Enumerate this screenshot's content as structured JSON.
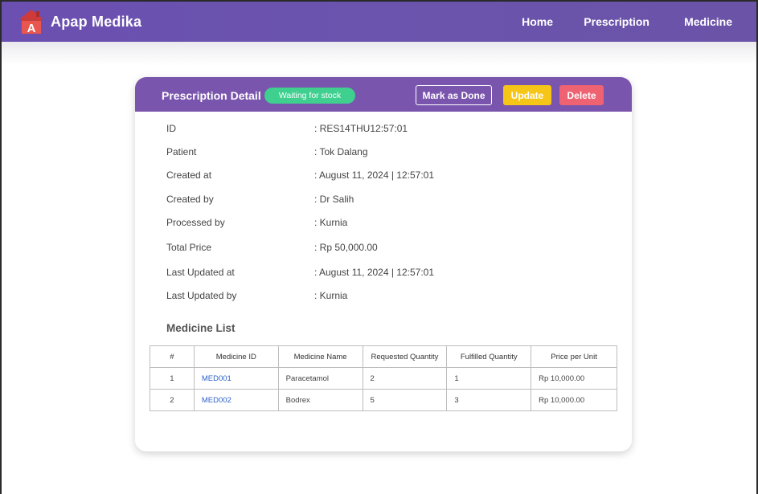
{
  "navbar": {
    "brand": "Apap Medika",
    "logo_letter": "A",
    "links": [
      "Home",
      "Prescription",
      "Medicine"
    ]
  },
  "card": {
    "title": "Prescription Detail",
    "status": "Waiting for stock",
    "buttons": {
      "mark_done": "Mark as Done",
      "update": "Update",
      "delete": "Delete"
    }
  },
  "details": [
    {
      "label": "ID",
      "value": ": RES14THU12:57:01"
    },
    {
      "label": "Patient",
      "value": ": Tok Dalang"
    },
    {
      "label": "Created at",
      "value": ": August 11, 2024 | 12:57:01"
    },
    {
      "label": "Created by",
      "value": ": Dr Salih"
    },
    {
      "label": "Processed by",
      "value": ": Kurnia"
    },
    {
      "label": "Total Price",
      "value": ": Rp 50,000.00"
    },
    {
      "label": "Last Updated at",
      "value": ": August 11, 2024 | 12:57:01"
    },
    {
      "label": "Last Updated by",
      "value": ": Kurnia"
    }
  ],
  "medicine_list": {
    "title": "Medicine List",
    "columns": [
      "#",
      "Medicine ID",
      "Medicine Name",
      "Requested Quantity",
      "Fulfilled Quantity",
      "Price per Unit"
    ],
    "rows": [
      [
        "1",
        "MED001",
        "Paracetamol",
        "2",
        "1",
        "Rp 10,000.00"
      ],
      [
        "2",
        "MED002",
        "Bodrex",
        "5",
        "3",
        "Rp 10,000.00"
      ]
    ]
  },
  "colors": {
    "navbar": "#6b4fb1",
    "card_header": "#7a55ad",
    "status": "#3fcf8f",
    "update": "#f5c518",
    "delete": "#ee6271",
    "link": "#2e62c9"
  }
}
